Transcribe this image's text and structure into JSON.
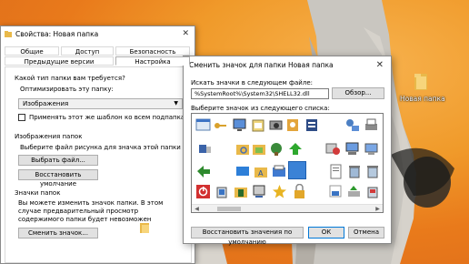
{
  "desktop": {
    "folder_label": "Новая папка"
  },
  "properties": {
    "title": "Свойства: Новая папка",
    "tabs": [
      "Общие",
      "Доступ",
      "Безопасность",
      "Предыдущие версии",
      "Настройка"
    ],
    "section_type_heading": "Какой тип папки вам требуется?",
    "optimize_label": "Оптимизировать эту папку:",
    "optimize_value": "Изображения",
    "apply_subfolders_label": "Применять этот же шаблон ко всем подпапкам",
    "section_images_heading": "Изображения папок",
    "images_hint": "Выберите файл рисунка для значка этой папки",
    "choose_file_button": "Выбрать файл...",
    "restore_default_button": "Восстановить умолчание",
    "section_icons_heading": "Значки папок",
    "icons_hint": "Вы можете изменить значок папки. В этом случае предварительный просмотр содержимого папки будет невозможен",
    "change_icon_button": "Сменить значок..."
  },
  "change_icon": {
    "title": "Сменить значок для папки Новая папка",
    "file_label": "Искать значки в следующем файле:",
    "file_path": "%SystemRoot%\\System32\\SHELL32.dll",
    "browse_button": "Обзор...",
    "list_label": "Выберите значок из следующего списка:",
    "restore_button": "Восстановить значения по умолчанию",
    "ok_button": "ОК",
    "cancel_button": "Отмена",
    "icons": [
      [
        "window-icon",
        "key-icon",
        "monitor-icon",
        "drive-icon",
        "printer-icon",
        "camera-icon",
        "certificate-icon",
        "network-icon",
        "magnifier-icon",
        "help-icon",
        "printer-alt-icon"
      ],
      [
        "device-icon",
        "folder-search-icon",
        "folder-tree-icon",
        "globe-icon",
        "arrow-up-icon",
        "help-circle-icon",
        "delete-x-icon",
        "network-drive-icon",
        "monitor-net-icon",
        "blank-icon",
        "blank-icon"
      ],
      [
        "arrow-left-icon",
        "tiles-icon",
        "folder-text-icon",
        "document-icon",
        "printer-blue-icon",
        "selected-icon",
        "document-lines-icon",
        "recycle-bin-icon",
        "recycle-bin-alt-icon",
        "blank-icon",
        "blank-icon"
      ],
      [
        "power-icon",
        "recycle-full-icon",
        "folder-cert-icon",
        "monitor-print-icon",
        "star-icon",
        "lock-icon",
        "blank-icon",
        "windows-flag-icon",
        "download-icon",
        "recycle-bin-full-icon",
        "blank-icon"
      ]
    ]
  }
}
